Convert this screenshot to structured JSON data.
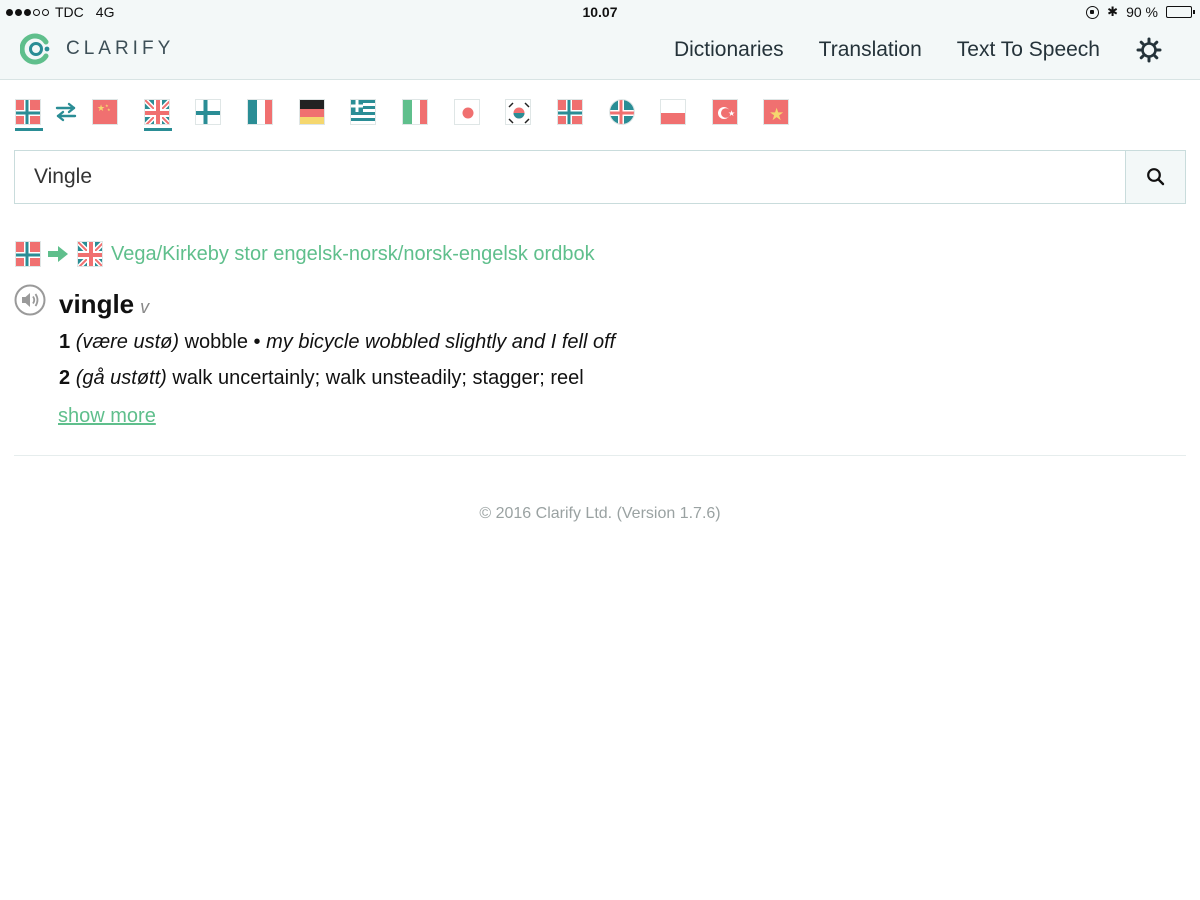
{
  "status_bar": {
    "carrier": "TDC",
    "network": "4G",
    "time": "10.07",
    "battery": "90 %",
    "battery_level": 0.9
  },
  "app": {
    "brand": "CLARIFY",
    "accent_color": "#5fbf8c",
    "teal_color": "#2a8d95"
  },
  "nav": {
    "items": [
      "Dictionaries",
      "Translation",
      "Text To Speech"
    ],
    "settings_icon": "gear-icon"
  },
  "language_flags": {
    "source": "norwegian-flag",
    "swap_icon": "swap-arrows-icon",
    "targets": [
      "chinese-flag",
      "uk-flag",
      "finnish-flag",
      "french-flag",
      "german-flag",
      "greek-flag",
      "italian-flag",
      "japanese-flag",
      "korean-flag",
      "norwegian-flag",
      "icelandic-flag",
      "polish-flag",
      "turkish-flag",
      "vietnamese-flag"
    ],
    "selected_target": "uk-flag"
  },
  "search": {
    "value": "Vingle",
    "icon": "search-icon"
  },
  "result": {
    "dictionary": "Vega/Kirkeby stor engelsk-norsk/norsk-engelsk ordbok",
    "headword": "vingle",
    "part_of_speech": "v",
    "senses": [
      {
        "number": "1",
        "context": "(være ustø)",
        "translation": "wobble",
        "separator": "•",
        "example": "my bicycle wobbled slightly and I fell off"
      },
      {
        "number": "2",
        "context": "(gå ustøtt)",
        "translation": "walk uncertainly; walk unsteadily; stagger; reel"
      }
    ],
    "show_more": "show more"
  },
  "footer": {
    "copyright": "© 2016 Clarify Ltd. (Version 1.7.6)"
  }
}
